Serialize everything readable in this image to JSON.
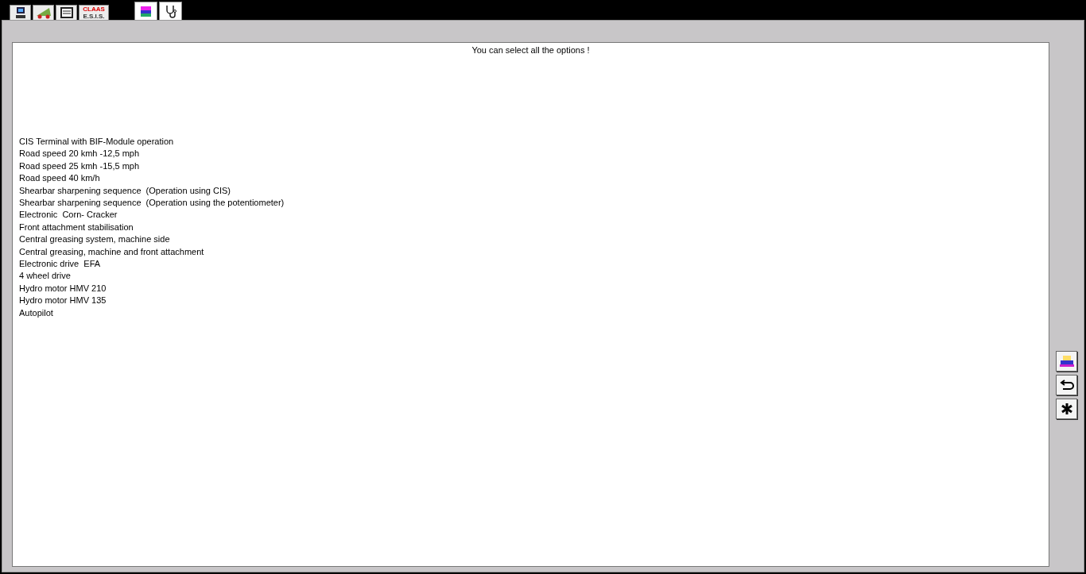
{
  "tabs": [
    {
      "kind": "computer",
      "selected": false
    },
    {
      "kind": "harvester",
      "selected": false
    },
    {
      "kind": "binder",
      "selected": false
    },
    {
      "kind": "logo",
      "lines": [
        "CLAAS",
        "E.S.I.S."
      ],
      "selected": false
    },
    {
      "kind": "books",
      "selected": true
    },
    {
      "kind": "stethoscope",
      "selected": true
    }
  ],
  "panel": {
    "heading": "You can select all the options !",
    "options": [
      "CIS Terminal with BIF-Module operation",
      "Road speed 20 kmh -12,5 mph",
      "Road speed 25 kmh -15,5 mph",
      "Road speed 40 km/h",
      "Shearbar sharpening sequence  (Operation using CIS)",
      "Shearbar sharpening sequence  (Operation using the potentiometer)",
      "Electronic  Corn- Cracker",
      "Front attachment stabilisation",
      "Central greasing system, machine side",
      "Central greasing, machine and front attachment",
      "Electronic drive  EFA",
      "4 wheel drive",
      "Hydro motor HMV 210",
      "Hydro motor HMV 135",
      "Autopilot"
    ]
  },
  "side_buttons": [
    {
      "kind": "print"
    },
    {
      "kind": "back"
    },
    {
      "kind": "asterisk"
    }
  ]
}
